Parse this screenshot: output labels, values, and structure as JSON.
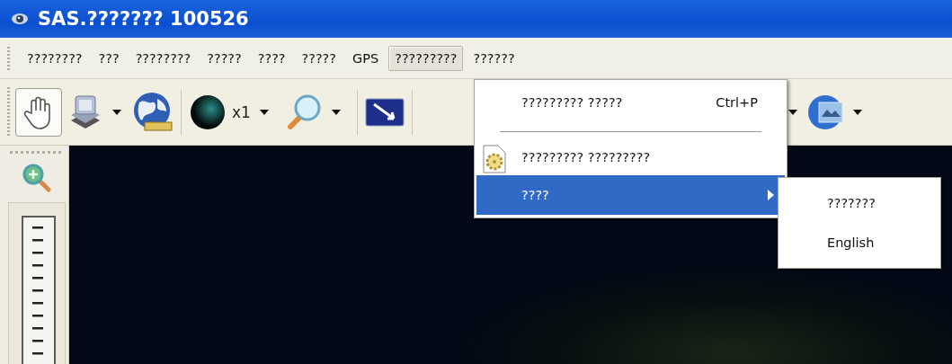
{
  "window": {
    "title": "SAS.??????? 100526"
  },
  "menu_bar": [
    {
      "label": "????????",
      "selected": false
    },
    {
      "label": "???",
      "selected": false
    },
    {
      "label": "????????",
      "selected": false
    },
    {
      "label": "?????",
      "selected": false
    },
    {
      "label": "????",
      "selected": false
    },
    {
      "label": "?????",
      "selected": false
    },
    {
      "label": "GPS",
      "selected": false
    },
    {
      "label": "?????????",
      "selected": true
    },
    {
      "label": "??????",
      "selected": false
    }
  ],
  "toolbar": {
    "hand_tool_selected": true,
    "zoom_factor": "x1"
  },
  "dropdown": [
    {
      "kind": "command",
      "label": "????????? ?????",
      "shortcut": "Ctrl+P",
      "selected": false
    },
    {
      "kind": "separator"
    },
    {
      "kind": "settings",
      "label": "????????? ?????????",
      "selected": false
    },
    {
      "kind": "submenu",
      "label": "????",
      "selected": true
    }
  ],
  "submenu": [
    {
      "label": "???????",
      "selected": false
    },
    {
      "label": "English",
      "selected": false
    }
  ]
}
